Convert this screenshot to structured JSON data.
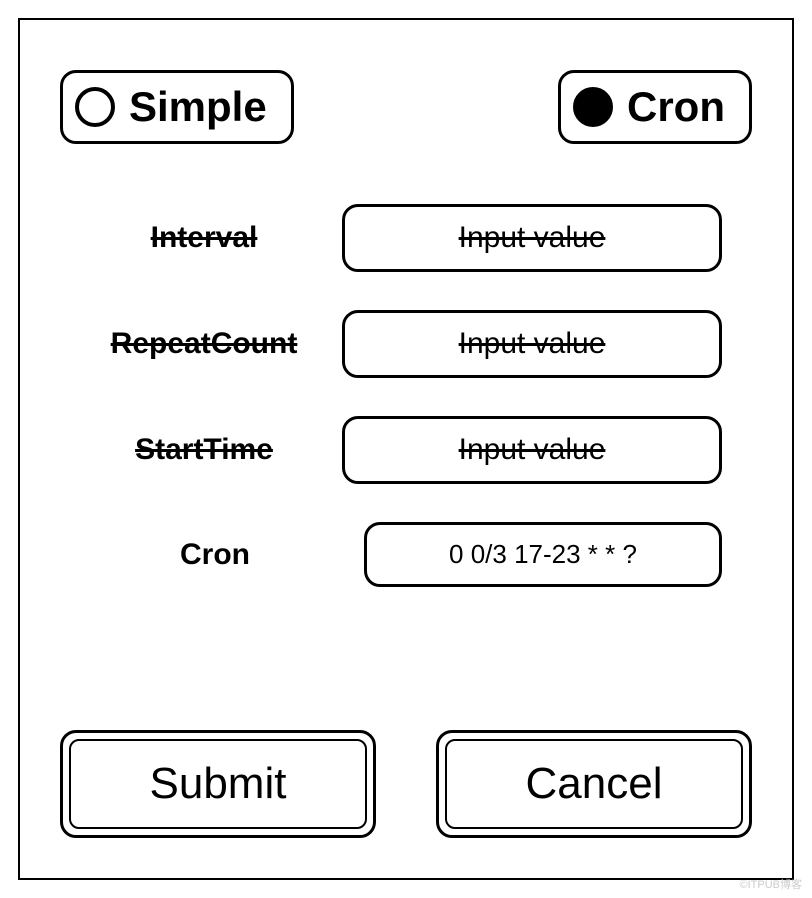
{
  "radios": {
    "simple": {
      "label": "Simple",
      "selected": false
    },
    "cron": {
      "label": "Cron",
      "selected": true
    }
  },
  "fields": {
    "interval": {
      "label": "Interval",
      "placeholder": "Input value",
      "value": "",
      "disabled": true
    },
    "repeatCount": {
      "label": "RepeatCount",
      "placeholder": "Input value",
      "value": "",
      "disabled": true
    },
    "startTime": {
      "label": "StartTime",
      "placeholder": "Input value",
      "value": "",
      "disabled": true
    },
    "cron": {
      "label": "Cron",
      "placeholder": "",
      "value": "0 0/3 17-23 * * ?",
      "disabled": false
    }
  },
  "buttons": {
    "submit": "Submit",
    "cancel": "Cancel"
  },
  "watermark": "©ITPUB博客"
}
